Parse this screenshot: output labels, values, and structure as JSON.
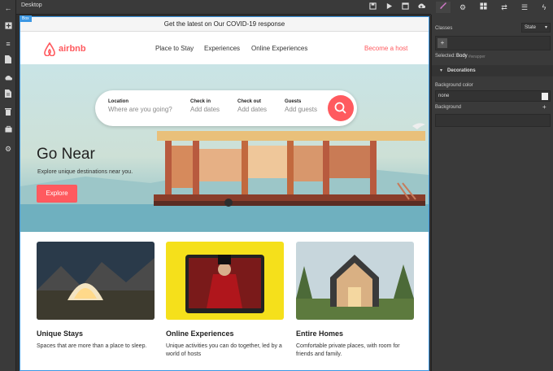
{
  "app": {
    "title": "Desktop",
    "colors": {
      "accent": "#ff5a5f",
      "selection": "#3b97e3",
      "panel": "#3a3a3a"
    }
  },
  "canvas": {
    "box_tag": "Box"
  },
  "site": {
    "banner": "Get the latest on Our COVID-19 response",
    "logo_text": "airbnb",
    "nav": [
      "Place to Stay",
      "Experiences",
      "Online Experiences"
    ],
    "host_link": "Become a host",
    "search": {
      "fields": [
        {
          "label": "Location",
          "placeholder": "Where are you going?"
        },
        {
          "label": "Check in",
          "placeholder": "Add dates"
        },
        {
          "label": "Check out",
          "placeholder": "Add dates"
        },
        {
          "label": "Guests",
          "placeholder": "Add guests"
        }
      ]
    },
    "hero": {
      "title": "Go Near",
      "subtitle": "Explore unique destinations near you.",
      "button": "Explore"
    },
    "cards": [
      {
        "title": "Unique Stays",
        "desc": "Spaces that are more than a place to sleep."
      },
      {
        "title": "Online Experiences",
        "desc": "Unique activities you can do together, led by a world of hosts"
      },
      {
        "title": "Entire Homes",
        "desc": "Comfortable private places, with room for friends and family."
      }
    ]
  },
  "panel": {
    "classes_label": "Classes",
    "state_label": "State",
    "add_label": "+",
    "selected_label": "Selected:",
    "selected_value": "Body",
    "selected_extra": "#wrapper",
    "decorations_label": "Decorations",
    "bg_color_label": "Background color",
    "bg_color_value": "none",
    "background_label": "Background",
    "background_add": "+"
  }
}
